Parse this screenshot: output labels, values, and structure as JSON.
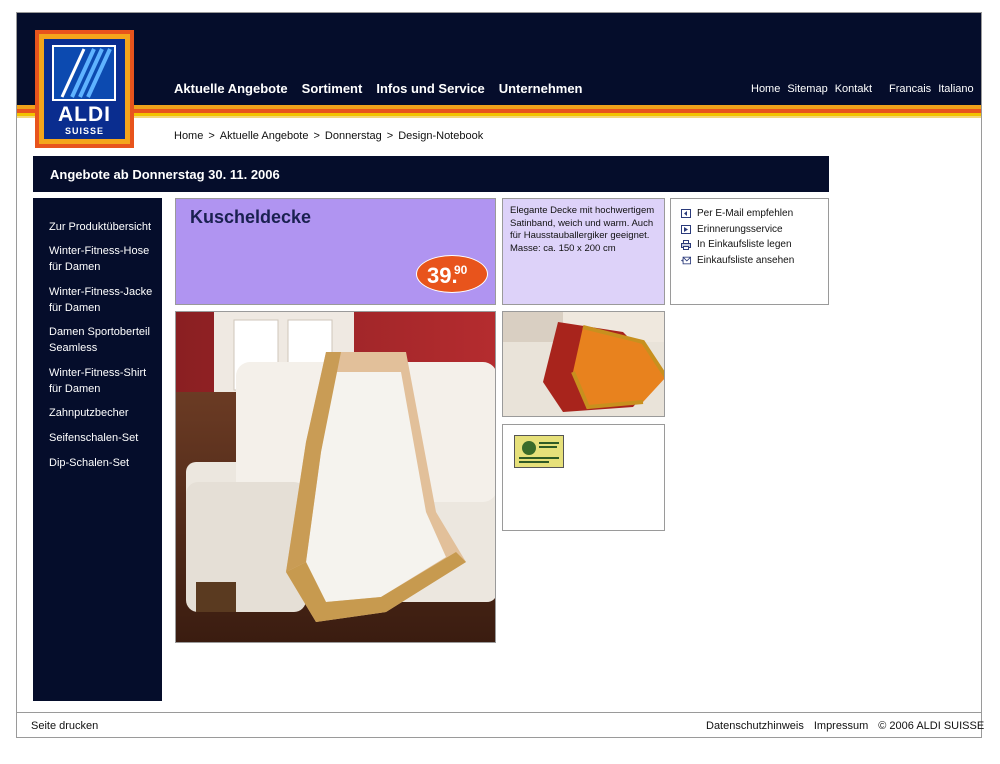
{
  "brand": {
    "name": "ALDI",
    "sub": "SUISSE"
  },
  "main_nav": [
    "Aktuelle Angebote",
    "Sortiment",
    "Infos und Service",
    "Unternehmen"
  ],
  "util_nav": [
    "Home",
    "Sitemap",
    "Kontakt"
  ],
  "lang_nav": [
    "Francais",
    "Italiano"
  ],
  "breadcrumb": [
    "Home",
    ">",
    "Aktuelle Angebote",
    ">",
    "Donnerstag",
    ">",
    "Design-Notebook"
  ],
  "banner": "Angebote ab Donnerstag 30. 11. 2006",
  "sidebar": [
    "Zur Produktübersicht",
    "Winter-Fitness-Hose für Damen",
    "Winter-Fitness-Jacke für Damen",
    "Damen Sportoberteil Seamless",
    "Winter-Fitness-Shirt für Damen",
    "Zahnputzbecher",
    "Seifenschalen-Set",
    "Dip-Schalen-Set"
  ],
  "product": {
    "title": "Kuscheldecke",
    "price_main": "39.",
    "price_cents": "90",
    "description": "Elegante Decke mit hochwertigem Satinband, weich und warm. Auch für Hausstauballergiker geeignet. Masse: ca. 150 x 200 cm"
  },
  "actions": [
    {
      "label": "Per E-Mail empfehlen",
      "icon": "email-forward-icon"
    },
    {
      "label": "Erinnerungsservice",
      "icon": "reminder-icon"
    },
    {
      "label": "In Einkaufsliste legen",
      "icon": "printer-icon"
    },
    {
      "label": "Einkaufsliste ansehen",
      "icon": "envelope-icon"
    }
  ],
  "footer": {
    "print": "Seite drucken",
    "links": [
      "Datenschutzhinweis",
      "Impressum",
      "© 2006 ALDI SUISSE"
    ]
  },
  "colors": {
    "navy": "#050d2b",
    "orange": "#e8541c",
    "lavender": "#b094f1",
    "light_lavender": "#ddd2f9"
  }
}
